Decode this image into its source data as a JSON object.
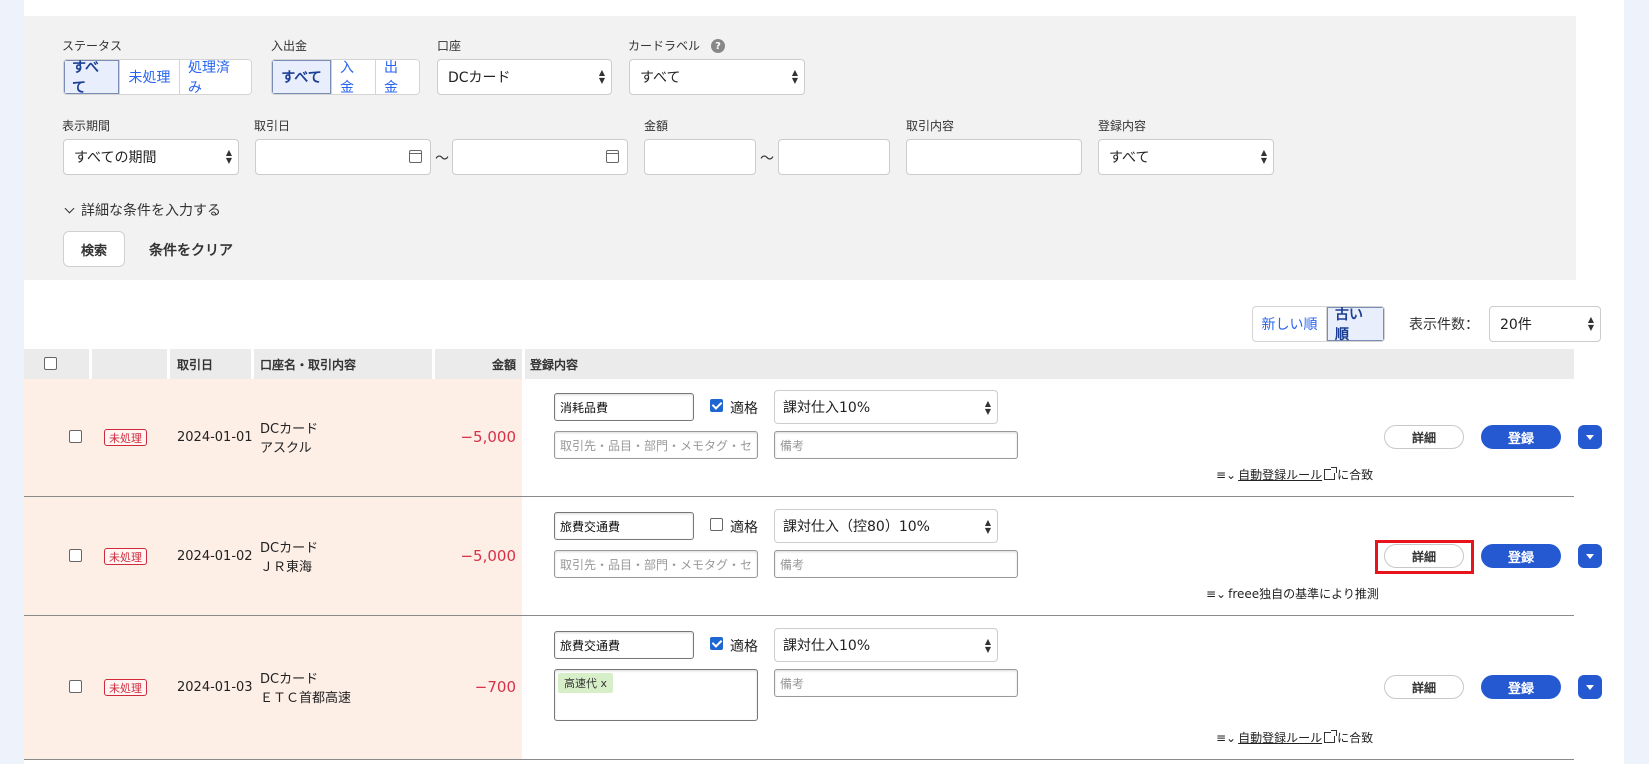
{
  "filters": {
    "status": {
      "label": "ステータス",
      "options": [
        "すべて",
        "未処理",
        "処理済み"
      ],
      "selected": "すべて"
    },
    "inout": {
      "label": "入出金",
      "options": [
        "すべて",
        "入金",
        "出金"
      ],
      "selected": "すべて"
    },
    "account": {
      "label": "口座",
      "value": "DCカード"
    },
    "card_label": {
      "label": "カードラベル",
      "value": "すべて"
    },
    "period": {
      "label": "表示期間",
      "value": "すべての期間"
    },
    "date": {
      "label": "取引日",
      "tilde": "〜"
    },
    "amount": {
      "label": "金額",
      "tilde": "〜"
    },
    "content": {
      "label": "取引内容"
    },
    "registration": {
      "label": "登録内容",
      "value": "すべて"
    },
    "advanced_toggle": "詳細な条件を入力する",
    "search_button": "検索",
    "clear_button": "条件をクリア"
  },
  "sort": {
    "options": [
      "新しい順",
      "古い順"
    ],
    "selected": "古い順"
  },
  "page_size": {
    "label": "表示件数：",
    "value": "20件"
  },
  "table": {
    "headers": {
      "date": "取引日",
      "account": "口座名・取引内容",
      "amount": "金額",
      "registration": "登録内容"
    },
    "rows": [
      {
        "status": "未処理",
        "date": "2024-01-01",
        "account": "DCカード",
        "description": "アスクル",
        "amount": "−5,000",
        "category": "消耗品費",
        "qualified": true,
        "qualified_label": "適格",
        "tax": "課対仕入10%",
        "partner_placeholder": "取引先・品目・部門・メモタグ・セ",
        "memo_placeholder": "備考",
        "detail": "詳細",
        "register": "登録",
        "note_link": "自動登録ルール",
        "note_suffix": "に合致",
        "note_text": ""
      },
      {
        "status": "未処理",
        "date": "2024-01-02",
        "account": "DCカード",
        "description": "ＪＲ東海",
        "amount": "−5,000",
        "category": "旅費交通費",
        "qualified": false,
        "qualified_label": "適格",
        "tax": "課対仕入（控80）10%",
        "partner_placeholder": "取引先・品目・部門・メモタグ・セ",
        "memo_placeholder": "備考",
        "detail": "詳細",
        "register": "登録",
        "note_text": "freee独自の基準により推測"
      },
      {
        "status": "未処理",
        "date": "2024-01-03",
        "account": "DCカード",
        "description": "ＥＴＣ首都高速",
        "amount": "−700",
        "category": "旅費交通費",
        "qualified": true,
        "qualified_label": "適格",
        "tax": "課対仕入10%",
        "tag": "高速代 x",
        "memo_placeholder": "備考",
        "detail": "詳細",
        "register": "登録",
        "note_link": "自動登録ルール",
        "note_suffix": "に合致"
      }
    ]
  },
  "colors": {
    "accent": "#2459d1",
    "highlight": "#e8141c",
    "unprocessed": "#d02a3a",
    "amount": "#d9304a"
  }
}
